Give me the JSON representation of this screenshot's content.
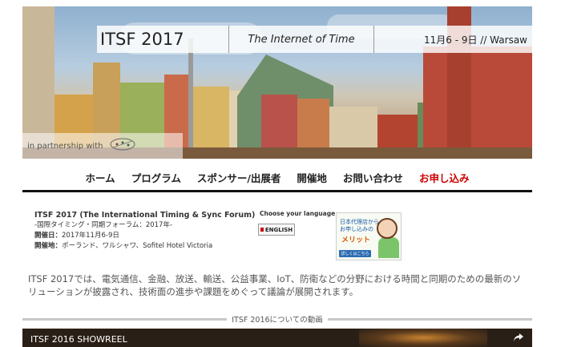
{
  "hero": {
    "title": "ITSF 2017",
    "subtitle": "The Internet of Time",
    "date_location": "11月6 - 9日 // Warsaw",
    "partnership_text": "in partnership with"
  },
  "nav": {
    "items": [
      "ホーム",
      "プログラム",
      "スポンサー/出展者",
      "開催地",
      "お問い合わせ",
      "お申し込み"
    ]
  },
  "info": {
    "title": "ITSF 2017 (The International Timing & Sync Forum)",
    "line1": "-国際タイミング・同期フォーラム：2017年-",
    "line2_label": "開催日：",
    "line2_value": "2017年11月6-9日",
    "line3_label": "開催地：",
    "line3_value": "ポーランド、ワルシャワ、Sofitel Hotel Victoria"
  },
  "language": {
    "label": "Choose your language",
    "button": "ENGLISH"
  },
  "agent_banner": {
    "line1": "日本代理店から",
    "line2": "お申し込みの",
    "merit": "メリット",
    "more": "詳しくはこちら"
  },
  "description": "ITSF 2017では、電気通信、金融、放送、輸送、公益事業、IoT、防衛などの分野における時間と同期のための最新のソリューションが披露され、技術面の進歩や課題をめぐって議論が展開されます。",
  "section": {
    "heading": "ITSF 2016についての動画"
  },
  "video": {
    "title": "ITSF 2016 SHOWREEL"
  },
  "colors": {
    "apply": "#cc0000",
    "nav_underline": "#111111",
    "merit": "#e05a00"
  }
}
